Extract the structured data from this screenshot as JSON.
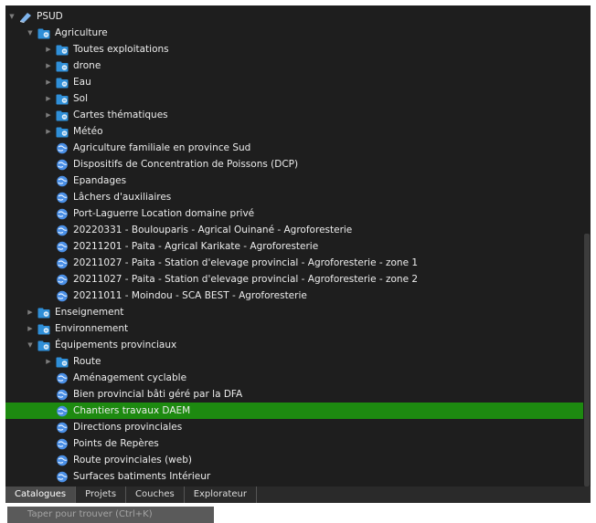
{
  "tree": {
    "root": {
      "label": "PSUD",
      "icon": "globe-icon"
    },
    "nodes": [
      {
        "name": "tree-folder-agriculture",
        "label": "Agriculture",
        "level": 1,
        "type": "folder",
        "state": "expanded"
      },
      {
        "name": "tree-folder-toutes-exploitations",
        "label": "Toutes exploitations",
        "level": 2,
        "type": "folder",
        "state": "collapsed"
      },
      {
        "name": "tree-folder-drone",
        "label": "drone",
        "level": 2,
        "type": "folder",
        "state": "collapsed"
      },
      {
        "name": "tree-folder-eau",
        "label": "Eau",
        "level": 2,
        "type": "folder",
        "state": "collapsed"
      },
      {
        "name": "tree-folder-sol",
        "label": "Sol",
        "level": 2,
        "type": "folder",
        "state": "collapsed"
      },
      {
        "name": "tree-folder-cartes-thematiques",
        "label": "Cartes thématiques",
        "level": 2,
        "type": "folder",
        "state": "collapsed"
      },
      {
        "name": "tree-folder-meteo",
        "label": "Météo",
        "level": 2,
        "type": "folder",
        "state": "collapsed"
      },
      {
        "name": "tree-layer-agriculture-familiale",
        "label": "Agriculture familiale en province Sud",
        "level": 2,
        "type": "layer"
      },
      {
        "name": "tree-layer-dcp",
        "label": "Dispositifs de Concentration de Poissons (DCP)",
        "level": 2,
        "type": "layer"
      },
      {
        "name": "tree-layer-epandages",
        "label": "Epandages",
        "level": 2,
        "type": "layer"
      },
      {
        "name": "tree-layer-lachers-auxiliaires",
        "label": "Lâchers d'auxiliaires",
        "level": 2,
        "type": "layer"
      },
      {
        "name": "tree-layer-port-laguerre",
        "label": "Port-Laguerre Location domaine privé",
        "level": 2,
        "type": "layer"
      },
      {
        "name": "tree-layer-20220331-boulouparis",
        "label": "20220331 - Boulouparis - Agrical Ouinané - Agroforesterie",
        "level": 2,
        "type": "layer"
      },
      {
        "name": "tree-layer-20211201-paita",
        "label": "20211201 - Paita - Agrical Karikate - Agroforesterie",
        "level": 2,
        "type": "layer"
      },
      {
        "name": "tree-layer-20211027-paita-zone1",
        "label": "20211027 - Paita - Station d'elevage provincial - Agroforesterie - zone 1",
        "level": 2,
        "type": "layer"
      },
      {
        "name": "tree-layer-20211027-paita-zone2",
        "label": "20211027 - Paita - Station d'elevage provincial - Agroforesterie - zone 2",
        "level": 2,
        "type": "layer"
      },
      {
        "name": "tree-layer-20211011-moindou",
        "label": "20211011 - Moindou - SCA BEST - Agroforesterie",
        "level": 2,
        "type": "layer"
      },
      {
        "name": "tree-folder-enseignement",
        "label": "Enseignement",
        "level": 1,
        "type": "folder",
        "state": "collapsed"
      },
      {
        "name": "tree-folder-environnement",
        "label": "Environnement",
        "level": 1,
        "type": "folder",
        "state": "collapsed"
      },
      {
        "name": "tree-folder-equipements-provinciaux",
        "label": "Équipements provinciaux",
        "level": 1,
        "type": "folder",
        "state": "expanded"
      },
      {
        "name": "tree-folder-route",
        "label": "Route",
        "level": 2,
        "type": "folder",
        "state": "collapsed"
      },
      {
        "name": "tree-layer-amenagement-cyclable",
        "label": "Aménagement cyclable",
        "level": 2,
        "type": "layer"
      },
      {
        "name": "tree-layer-bien-provincial",
        "label": "Bien provincial bâti géré par la DFA",
        "level": 2,
        "type": "layer"
      },
      {
        "name": "tree-layer-chantiers-travaux-daem",
        "label": "Chantiers travaux DAEM",
        "level": 2,
        "type": "layer",
        "selected": true
      },
      {
        "name": "tree-layer-directions-provinciales",
        "label": "Directions provinciales",
        "level": 2,
        "type": "layer"
      },
      {
        "name": "tree-layer-points-de-reperes",
        "label": "Points de Repères",
        "level": 2,
        "type": "layer"
      },
      {
        "name": "tree-layer-route-provinciales-web",
        "label": "Route provinciales (web)",
        "level": 2,
        "type": "layer"
      },
      {
        "name": "tree-layer-surfaces-batiments",
        "label": "Surfaces batiments Intérieur",
        "level": 2,
        "type": "layer"
      }
    ]
  },
  "tabs": [
    {
      "name": "tab-catalogues",
      "label": "Catalogues",
      "active": true
    },
    {
      "name": "tab-projets",
      "label": "Projets"
    },
    {
      "name": "tab-couches",
      "label": "Couches"
    },
    {
      "name": "tab-explorateur",
      "label": "Explorateur"
    }
  ],
  "search": {
    "placeholder": "Taper pour trouver (Ctrl+K)"
  },
  "colors": {
    "panel_bg": "#1e1e1e",
    "selected_row": "#1d8a10",
    "folder_icon": "#2f8fd8",
    "layer_icon": "#4a8fe6"
  }
}
